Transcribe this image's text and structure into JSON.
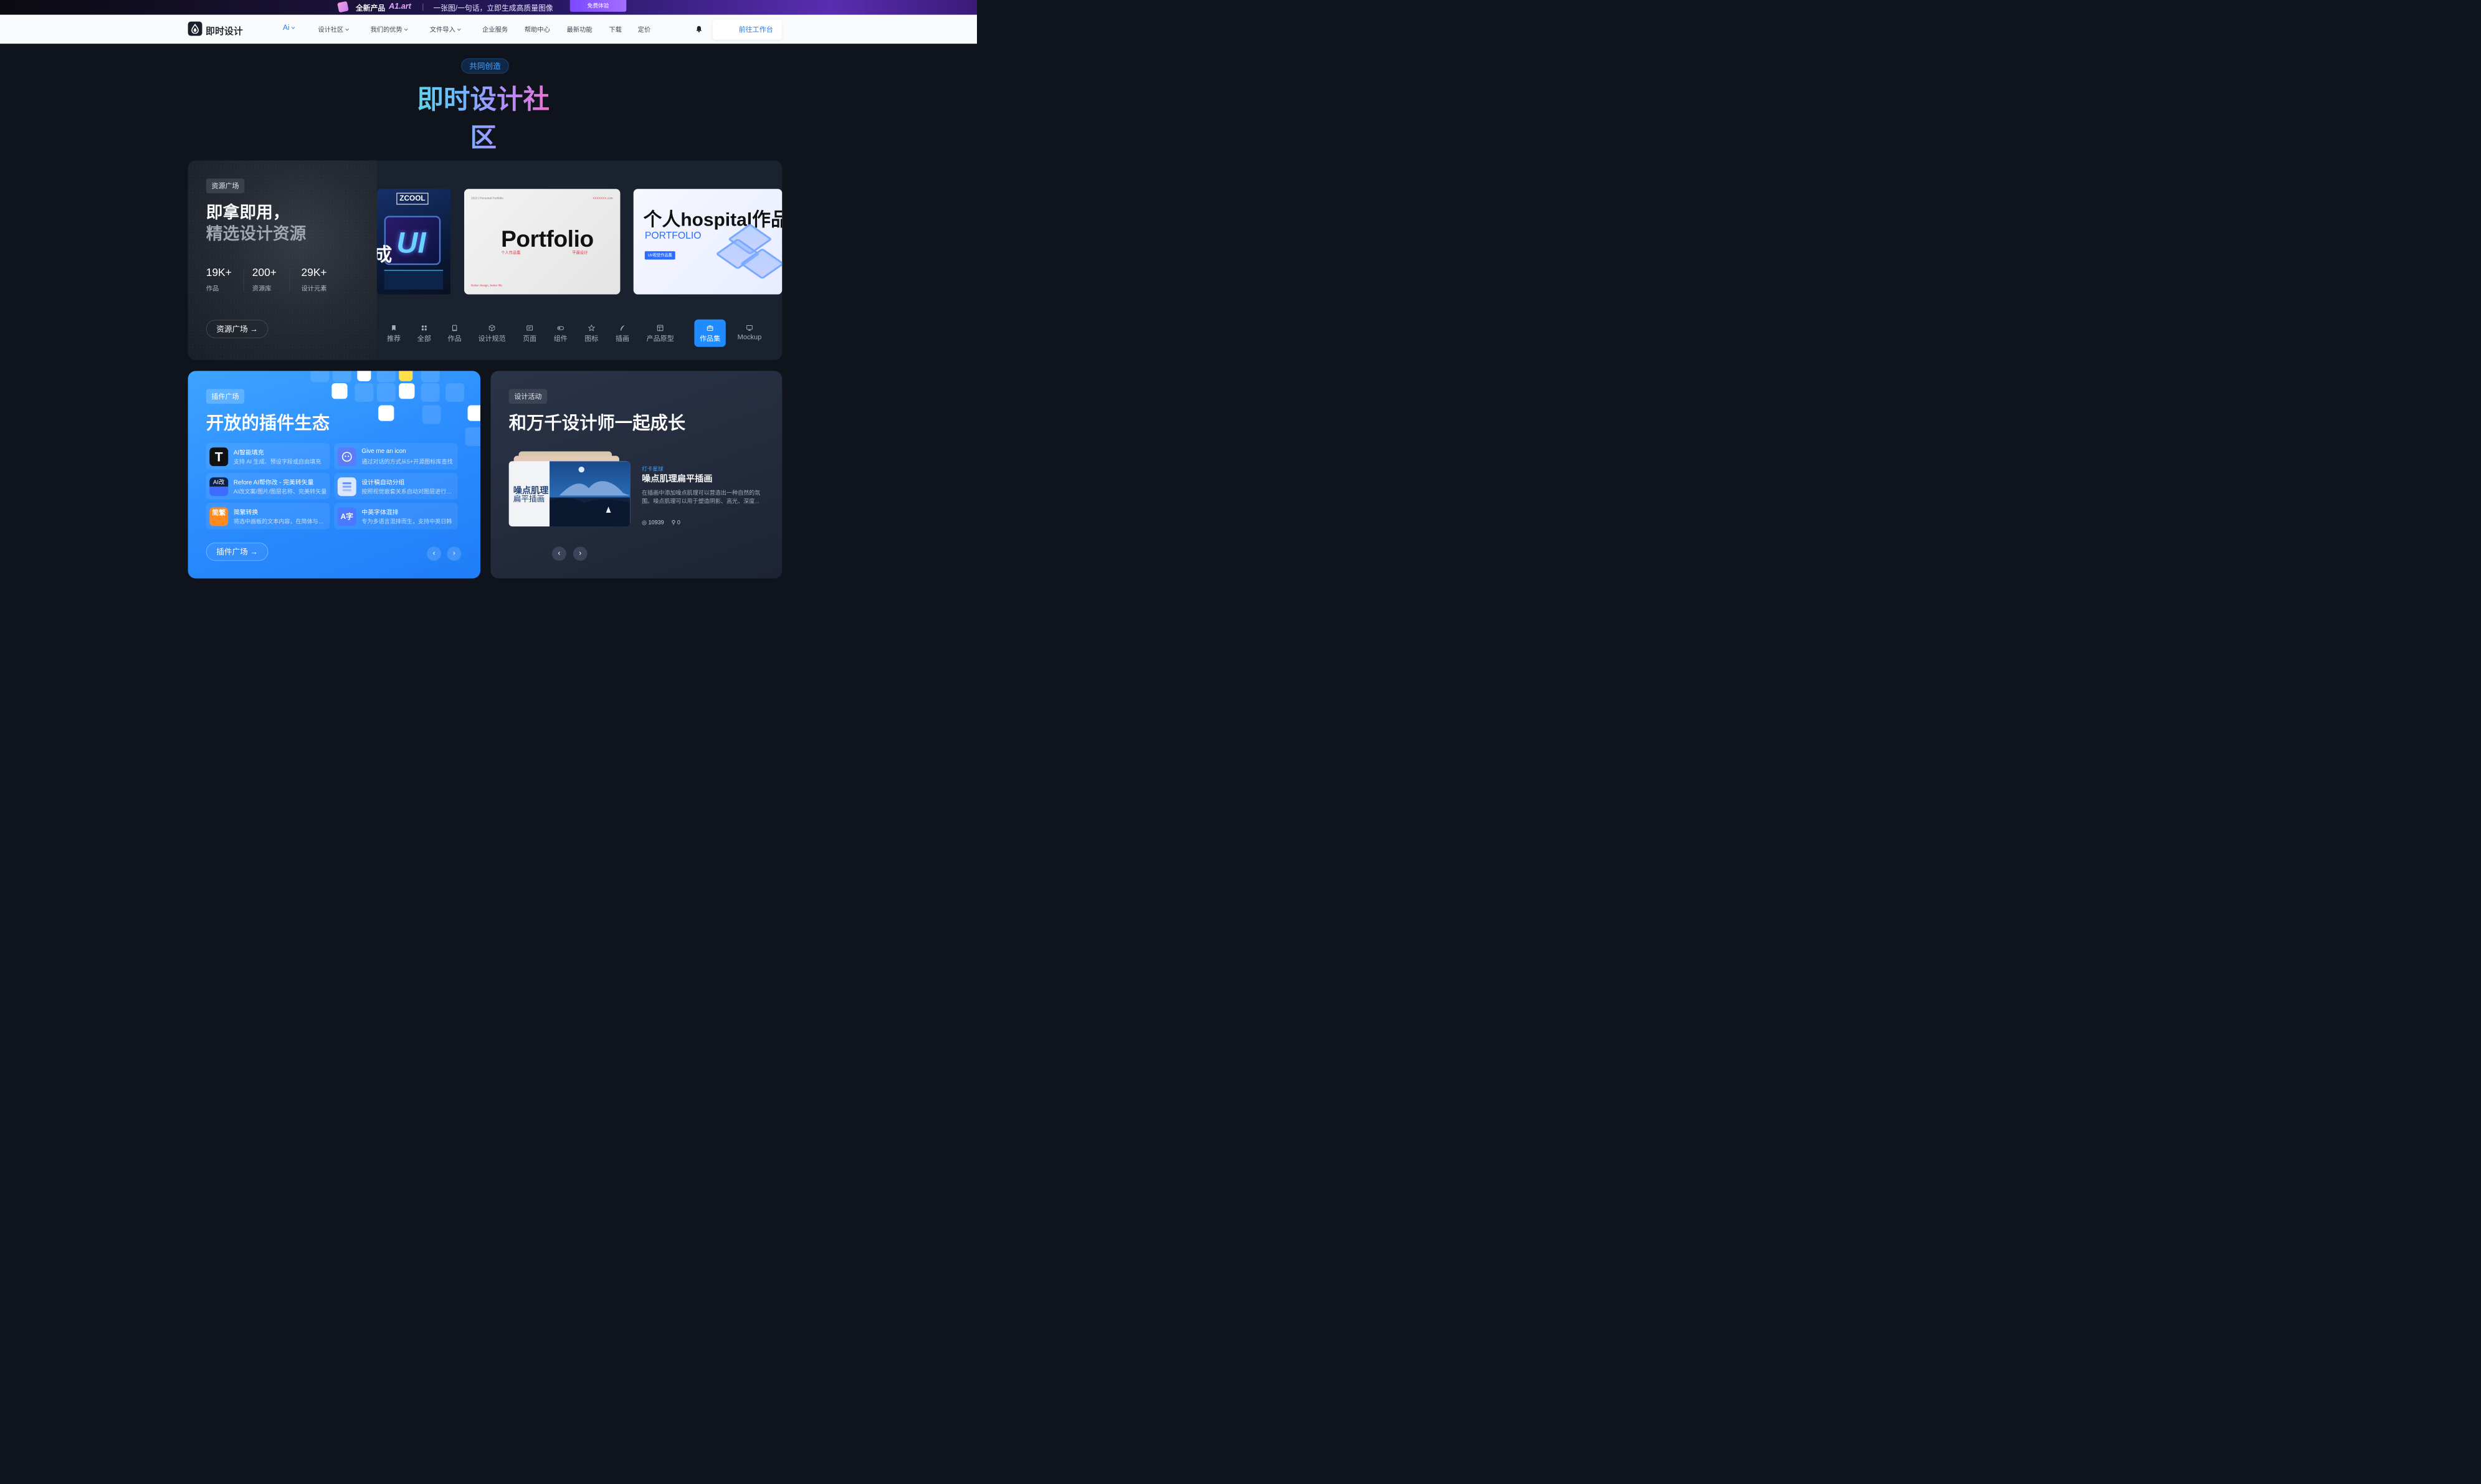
{
  "promo": {
    "tag": "全新产品",
    "product": "A1.art",
    "text": "一张图/一句话，立即生成高质量图像",
    "cta": "免费体验"
  },
  "brand": {
    "name": "即时设计"
  },
  "nav": {
    "ai": "Ai",
    "items": [
      "设计社区",
      "我们的优势",
      "文件导入",
      "企业服务",
      "帮助中心",
      "最新功能",
      "下载",
      "定价"
    ],
    "cta": "前往工作台"
  },
  "hero": {
    "pill": "共同创造",
    "title": "即时设计社区"
  },
  "resources": {
    "tag": "资源广场",
    "title1": "即拿即用，",
    "title2": "精选设计资源",
    "stats": [
      {
        "value": "19K+",
        "label": "作品"
      },
      {
        "value": "200+",
        "label": "资源库"
      },
      {
        "value": "29K+",
        "label": "设计元素"
      }
    ],
    "button": "资源广场 →",
    "thumbs": {
      "t1_logo": "ZCOOL",
      "t1_text": "UI",
      "t1_cn": "成",
      "t2_text": "Portfolio",
      "t2_red1": "个人作品集",
      "t2_red2": "平面设计",
      "t2_tiny": "2023 | Personal Portfolio",
      "t2_tr": "XXXXXXX.com",
      "t2_bl": "Better design, better life",
      "t3_title": "个人hospital作品集",
      "t3_sub": "PORTFOLIO",
      "t3_chip": "UI/视觉作品集"
    },
    "categories": [
      "推荐",
      "全部",
      "作品",
      "设计规范",
      "页面",
      "组件",
      "图标",
      "插画",
      "产品原型",
      "作品集",
      "Mockup"
    ],
    "active_category": "作品集"
  },
  "plugins": {
    "tag": "插件广场",
    "title": "开放的插件生态",
    "items": [
      {
        "title": "AI智能填充",
        "desc": "支持 AI 生成、预设字段或自由填充",
        "icon": "T"
      },
      {
        "title": "Give me an icon",
        "desc": "通过对话的方式从5+开源图标库查找",
        "icon": "icon"
      },
      {
        "title": "Refore AI帮你改 - 完美转矢量",
        "desc": "AI改文案/图片/图层名称、完美转矢量",
        "icon": "AI改"
      },
      {
        "title": "设计稿自动分组",
        "desc": "按照视觉嵌套关系自动对图层进行分组",
        "icon": "group"
      },
      {
        "title": "简繁转换",
        "desc": "将选中画板的文本内容，在简体与繁体间转换",
        "icon": "简繁"
      },
      {
        "title": "中英字体混排",
        "desc": "专为多语言混排而生，支持中英日韩",
        "icon": "A字"
      }
    ],
    "button": "插件广场 →"
  },
  "activities": {
    "tag": "设计活动",
    "title": "和万千设计师一起成长",
    "poster_title": "噪点肌理",
    "poster_sub": "扁平插画",
    "kicker": "打卡星球",
    "item_title": "噪点肌理扁平插画",
    "item_desc": "在插画中添加噪点肌理可以营造出一种自然的氛围。噪点肌理可以用于塑造阴影、高光、深度...",
    "views": "10939",
    "participants": "0"
  },
  "colors": {
    "accent": "#1f8bff",
    "bg": "#0f141c",
    "card": "#1a2230"
  }
}
